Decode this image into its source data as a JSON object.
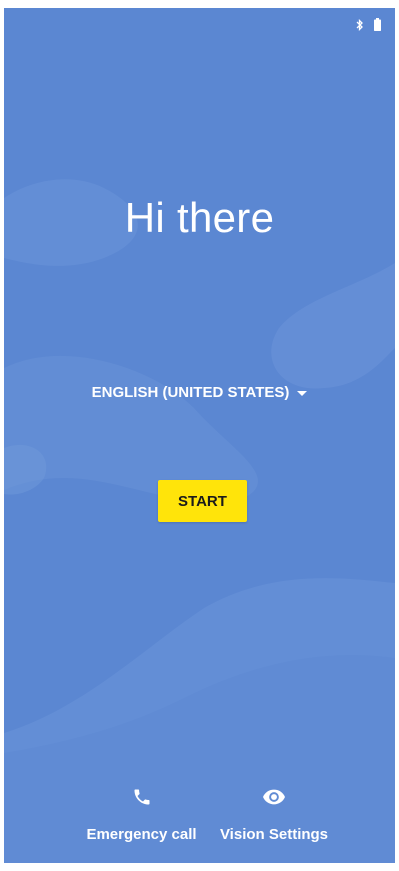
{
  "colors": {
    "background": "#5b87d2",
    "start_button": "#ffe40a",
    "text": "#ffffff"
  },
  "status_bar": {
    "icons": [
      "bluetooth-icon",
      "battery-icon"
    ]
  },
  "welcome": {
    "title": "Hi there",
    "language": "ENGLISH (UNITED STATES)",
    "start_label": "START"
  },
  "bottom": {
    "emergency_label": "Emergency call",
    "emergency_icon": "phone-icon",
    "vision_label": "Vision Settings",
    "vision_icon": "eye-icon"
  }
}
